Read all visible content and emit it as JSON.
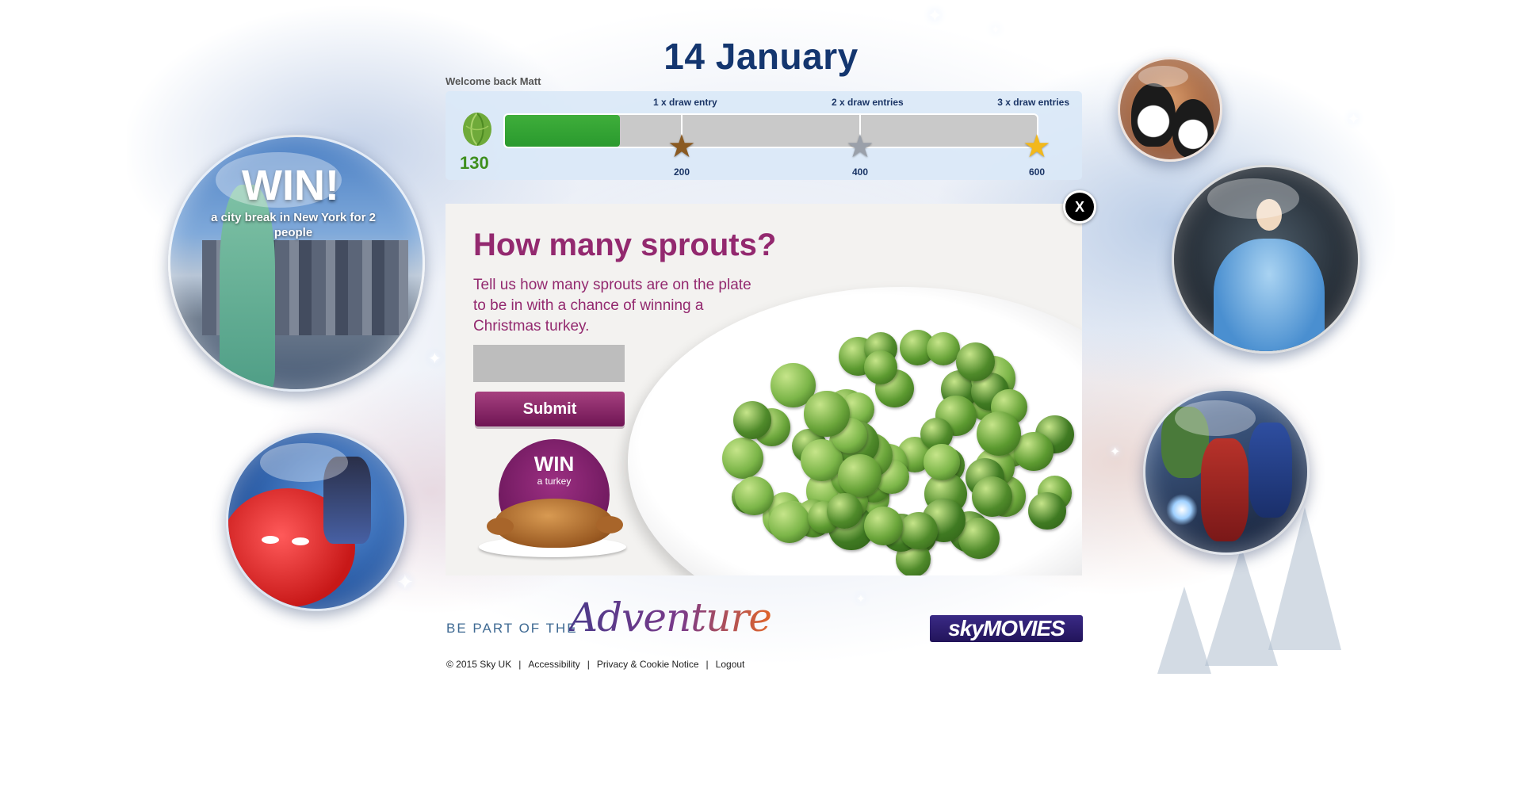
{
  "header": {
    "date": "14 January",
    "welcome": "Welcome back Matt"
  },
  "progress": {
    "points": "130",
    "current_value": 130,
    "max_value": 600,
    "fill_color": "#2a9a2e",
    "tiers": [
      {
        "label": "1 x draw entry",
        "threshold": "200",
        "star_color": "#8a5a22"
      },
      {
        "label": "2 x draw entries",
        "threshold": "400",
        "star_color": "#9aa0aa"
      },
      {
        "label": "3 x draw entries",
        "threshold": "600",
        "star_color": "#f2b81c"
      }
    ]
  },
  "quiz": {
    "heading": "How many sprouts?",
    "description": "Tell us how many sprouts are on the plate to be in with a chance of winning a Christmas turkey.",
    "answer_value": "",
    "answer_placeholder": "",
    "submit_label": "Submit",
    "close_label": "X",
    "badge_title": "WIN",
    "badge_subtitle": "a turkey"
  },
  "bubbles": {
    "new_york": {
      "title": "WIN!",
      "subtitle": "a city break in New York for 2 people"
    }
  },
  "footer": {
    "tagline_lead": "BE PART OF THE",
    "tagline_script": "Adventure",
    "brand": "skyMOVIES",
    "copyright": "© 2015 Sky UK",
    "links": [
      "Accessibility",
      "Privacy & Cookie Notice",
      "Logout"
    ]
  },
  "colors": {
    "title_blue": "#14366f",
    "accent_purple": "#93296f",
    "points_green": "#3f8f1e"
  }
}
